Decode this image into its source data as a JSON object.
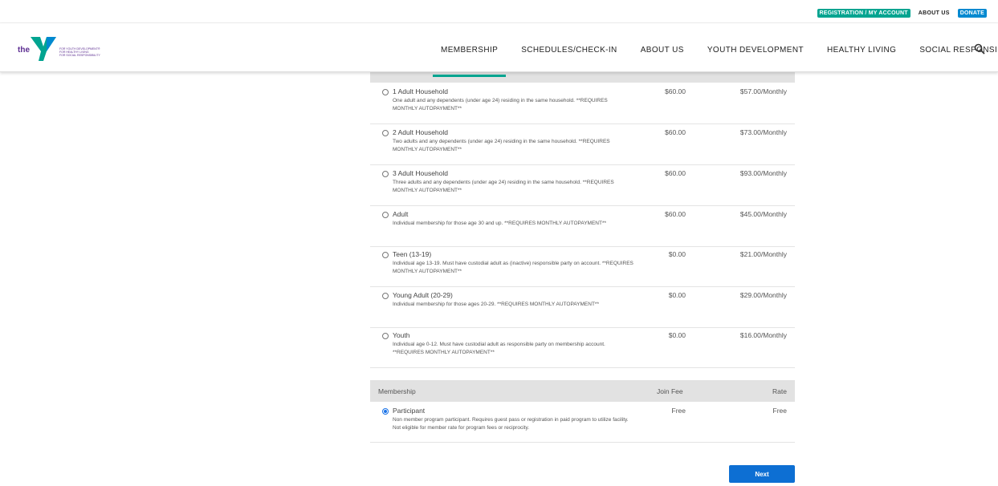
{
  "topbar": {
    "registration": "REGISTRATION / MY ACCOUNT",
    "about": "ABOUT US",
    "donate": "DONATE"
  },
  "logo": {
    "the": "the",
    "tagline": [
      "FOR YOUTH DEVELOPMENT®",
      "FOR HEALTHY LIVING",
      "FOR SOCIAL RESPONSIBILITY"
    ]
  },
  "nav": [
    "MEMBERSHIP",
    "SCHEDULES/CHECK-IN",
    "ABOUT US",
    "YOUTH DEVELOPMENT",
    "HEALTHY LIVING",
    "SOCIAL RESPONSIBILITY"
  ],
  "table1": {
    "rows": [
      {
        "name": "1 Adult Household",
        "desc": "One adult and any dependents (under age 24) residing in the same household. **REQUIRES MONTHLY AUTOPAYMENT**",
        "fee": "$60.00",
        "rate": "$57.00/Monthly"
      },
      {
        "name": "2 Adult Household",
        "desc": "Two adults and any dependents (under age 24) residing in the same household. **REQUIRES MONTHLY AUTOPAYMENT**",
        "fee": "$60.00",
        "rate": "$73.00/Monthly"
      },
      {
        "name": "3 Adult Household",
        "desc": "Three adults and any dependents (under age 24) residing in the same household. **REQUIRES MONTHLY AUTOPAYMENT**",
        "fee": "$60.00",
        "rate": "$93.00/Monthly"
      },
      {
        "name": "Adult",
        "desc": "Individual membership for those age 30 and up. **REQUIRES MONTHLY AUTOPAYMENT**",
        "fee": "$60.00",
        "rate": "$45.00/Monthly"
      },
      {
        "name": "Teen (13-19)",
        "desc": "Individual age 13-19. Must have custodial adult as (inactive) responsible party on account. **REQUIRES MONTHLY AUTOPAYMENT**",
        "fee": "$0.00",
        "rate": "$21.00/Monthly"
      },
      {
        "name": "Young Adult (20-29)",
        "desc": "Individual membership for those ages 20-29. **REQUIRES MONTHLY AUTOPAYMENT**",
        "fee": "$0.00",
        "rate": "$29.00/Monthly"
      },
      {
        "name": "Youth",
        "desc": "Individual age 0-12. Must have custodial adult as responsible party on membership account. **REQUIRES MONTHLY AUTOPAYMENT**",
        "fee": "$0.00",
        "rate": "$16.00/Monthly"
      }
    ]
  },
  "table2": {
    "header": {
      "membership": "Membership",
      "fee": "Join Fee",
      "rate": "Rate"
    },
    "rows": [
      {
        "name": "Participant",
        "desc": "Non member program participant. Requires guest pass or registration in paid program to utilize facility. Not eligible for member rate for program fees or reciprocity.",
        "fee": "Free",
        "rate": "Free"
      }
    ]
  },
  "next_label": "Next"
}
